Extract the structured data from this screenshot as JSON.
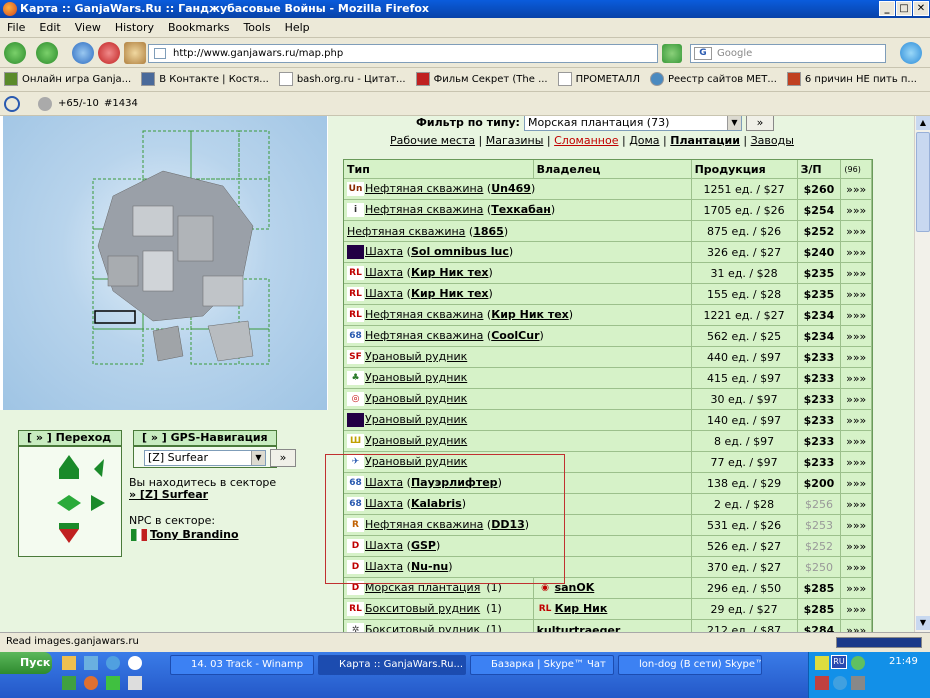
{
  "window": {
    "title": "Карта :: GanjaWars.Ru :: Ганджубасовые Войны - Mozilla Firefox"
  },
  "menu": [
    "File",
    "Edit",
    "View",
    "History",
    "Bookmarks",
    "Tools",
    "Help"
  ],
  "nav": {
    "url": "http://www.ganjawars.ru/map.php",
    "search_placeholder": "Google"
  },
  "bookmarks": [
    "Онлайн игра Ganja...",
    "В Контакте | Костя...",
    "bash.org.ru - Цитат...",
    "Фильм Секрет (The ...",
    "ПРОМЕТАЛЛ",
    "Реестр сайтов МЕТ...",
    "6 причин НЕ пить п..."
  ],
  "toolbar2": {
    "rating": "+65/-10",
    "counter": "#1434"
  },
  "filter": {
    "label": "Фильтр по типу:",
    "selected": "Морская плантация (73)",
    "go": "»"
  },
  "categories": [
    {
      "label": "Рабочие места",
      "color": "#000"
    },
    {
      "label": "Магазины",
      "color": "#000"
    },
    {
      "label": "Сломанное",
      "color": "#c00000"
    },
    {
      "label": "Дома",
      "color": "#000"
    },
    {
      "label": "Плантации",
      "color": "#000",
      "bold": true
    },
    {
      "label": "Заводы",
      "color": "#000"
    }
  ],
  "table": {
    "headers": [
      "Тип",
      "Владелец",
      "Продукция",
      "З/П",
      "(96)"
    ],
    "rows": [
      {
        "logo": "Un",
        "logo_color": "#8a2a00",
        "type": "Нефтяная скважина",
        "owner": "Un469",
        "prod": "1251 ед. / $27",
        "wage": "$260",
        "more": "»»»"
      },
      {
        "logo": "i",
        "logo_color": "#333",
        "type": "Нефтяная скважина",
        "owner": "Техкабан",
        "prod": "1705 ед. / $26",
        "wage": "$254",
        "more": "»»»"
      },
      {
        "logo": "",
        "logo_color": "",
        "type": "Нефтяная скважина",
        "owner": "1865",
        "prod": "875 ед. / $26",
        "wage": "$252",
        "more": "»»»"
      },
      {
        "logo": "",
        "logo_color": "#220044",
        "type": "Шахта",
        "owner": "Sol omnibus luc",
        "prod": "326 ед. / $27",
        "wage": "$240",
        "more": "»»»"
      },
      {
        "logo": "RL",
        "logo_color": "#c00000",
        "type": "Шахта",
        "owner": "Кир Ник тех",
        "prod": "31 ед. / $28",
        "wage": "$235",
        "more": "»»»"
      },
      {
        "logo": "RL",
        "logo_color": "#c00000",
        "type": "Шахта",
        "owner": "Кир Ник тех",
        "prod": "155 ед. / $28",
        "wage": "$235",
        "more": "»»»"
      },
      {
        "logo": "RL",
        "logo_color": "#c00000",
        "type": "Нефтяная скважина",
        "owner": "Кир Ник тех",
        "prod": "1221 ед. / $27",
        "wage": "$234",
        "more": "»»»"
      },
      {
        "logo": "68",
        "logo_color": "#2a5ab0",
        "type": "Нефтяная скважина",
        "owner": "CoolCur",
        "prod": "562 ед. / $25",
        "wage": "$234",
        "more": "»»»"
      },
      {
        "logo": "SF",
        "logo_color": "#c00000",
        "type": "Урановый рудник",
        "owner": "",
        "prod": "440 ед. / $97",
        "wage": "$233",
        "more": "»»»"
      },
      {
        "logo": "♣",
        "logo_color": "#2a7a2a",
        "type": "Урановый рудник",
        "owner": "",
        "prod": "415 ед. / $97",
        "wage": "$233",
        "more": "»»»"
      },
      {
        "logo": "◎",
        "logo_color": "#c00000",
        "type": "Урановый рудник",
        "owner": "",
        "prod": "30 ед. / $97",
        "wage": "$233",
        "more": "»»»"
      },
      {
        "logo": "",
        "logo_color": "#220044",
        "type": "Урановый рудник",
        "owner": "",
        "prod": "140 ед. / $97",
        "wage": "$233",
        "more": "»»»"
      },
      {
        "logo": "Ш",
        "logo_color": "#c0a000",
        "type": "Урановый рудник",
        "owner": "",
        "prod": "8 ед. / $97",
        "wage": "$233",
        "more": "»»»"
      },
      {
        "logo": "✈",
        "logo_color": "#2a5ab0",
        "type": "Урановый рудник",
        "owner": "",
        "prod": "77 ед. / $97",
        "wage": "$233",
        "more": "»»»"
      },
      {
        "logo": "68",
        "logo_color": "#2a5ab0",
        "type": "Шахта",
        "owner": "Пауэрлифтер",
        "prod": "138 ед. / $29",
        "wage": "$200",
        "more": "»»»"
      },
      {
        "logo": "68",
        "logo_color": "#2a5ab0",
        "type": "Шахта",
        "owner": "Kalabris",
        "prod": "2 ед. / $28",
        "wage": "$256",
        "more": "»»»",
        "gray": true
      },
      {
        "logo": "R",
        "logo_color": "#c06000",
        "type": "Нефтяная скважина",
        "owner": "DD13",
        "prod": "531 ед. / $26",
        "wage": "$253",
        "more": "»»»",
        "gray": true
      },
      {
        "logo": "D",
        "logo_color": "#c00000",
        "type": "Шахта",
        "owner": "GSP",
        "prod": "526 ед. / $27",
        "wage": "$252",
        "more": "»»»",
        "gray": true
      },
      {
        "logo": "D",
        "logo_color": "#c00000",
        "type": "Шахта",
        "owner": "Nu-nu",
        "prod": "370 ед. / $27",
        "wage": "$250",
        "more": "»»»",
        "gray": true
      },
      {
        "logo": "D",
        "logo_color": "#c00000",
        "type": "Морская плантация",
        "owner": "",
        "count": "(1)",
        "owner2": "sanOK",
        "owner2_logo": "◉",
        "prod": "296 ед. / $50",
        "wage": "$285",
        "more": "»»»"
      },
      {
        "logo": "RL",
        "logo_color": "#c00000",
        "type": "Бокситовый рудник",
        "owner": "",
        "count": "(1)",
        "owner2": "Кир Ник",
        "owner2_logo": "RL",
        "prod": "29 ед. / $27",
        "wage": "$285",
        "more": "»»»"
      },
      {
        "logo": "✲",
        "logo_color": "#444",
        "type": "Бокситовый рудник",
        "owner": "",
        "count": "(1)",
        "owner2": "kulturtraeger",
        "owner2_logo": "",
        "prod": "212 ед. / $87",
        "wage": "$284",
        "more": "»»»"
      }
    ]
  },
  "left": {
    "goto_label": "[ » ] Переход",
    "gps_label": "[ » ] GPS-Навигация",
    "gps_selected": "[Z] Surfear",
    "gps_go": "»",
    "sector_text": "Вы находитесь в секторе",
    "sector_link": "» [Z] Surfear",
    "npc_label": "NPC в секторе:",
    "npc_name": "Tony Brandino"
  },
  "status": "Read images.ganjawars.ru",
  "taskbar": {
    "start": "Пуск",
    "tasks": [
      "14. 03 Track - Winamp",
      "Карта :: GanjaWars.Ru...",
      "Базарка | Skype™ Чат",
      "lon-dog (В сети) Skype™ ..."
    ],
    "lang": "RU",
    "clock": "21:49"
  }
}
